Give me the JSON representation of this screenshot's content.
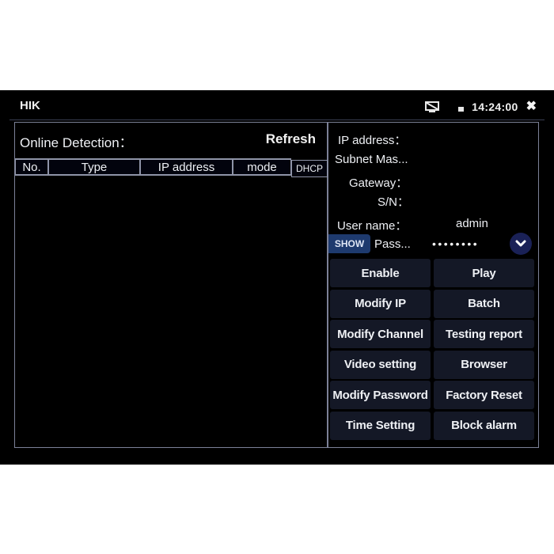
{
  "statusbar": {
    "app_title": "HIK",
    "cast_icon": "screen-cast-off-icon",
    "battery_icon": "battery-icon",
    "time": "14:24:00",
    "close_icon": "close-icon",
    "close_glyph": "✖"
  },
  "online_detection": {
    "title": "Online Detection：",
    "refresh_label": "Refresh",
    "columns": [
      "No.",
      "Type",
      "IP address",
      "mode",
      "DHCP"
    ],
    "rows": []
  },
  "device_info": {
    "ip_address_label": "IP address：",
    "ip_address_value": "",
    "subnet_mask_label": "Subnet Mas...",
    "subnet_mask_value": "",
    "gateway_label": "Gateway：",
    "gateway_value": "",
    "sn_label": "S/N：",
    "sn_value": "",
    "username_label": "User name：",
    "username_value": "admin",
    "password_label": "Pass...",
    "password_value": "••••••••",
    "show_label": "SHOW",
    "dropdown_icon": "chevron-down-icon"
  },
  "actions": [
    "Enable",
    "Play",
    "Modify IP",
    "Batch",
    "Modify Channel",
    "Testing report",
    "Video setting",
    "Browser",
    "Modify Password",
    "Factory Reset",
    "Time Setting",
    "Block alarm"
  ],
  "colors": {
    "background": "#000000",
    "panel_border": "#7c8197",
    "button_bg": "#141826",
    "show_bg": "#1e3a6e",
    "dropdown_bg": "#1a2157",
    "text": "#eef0f4"
  }
}
